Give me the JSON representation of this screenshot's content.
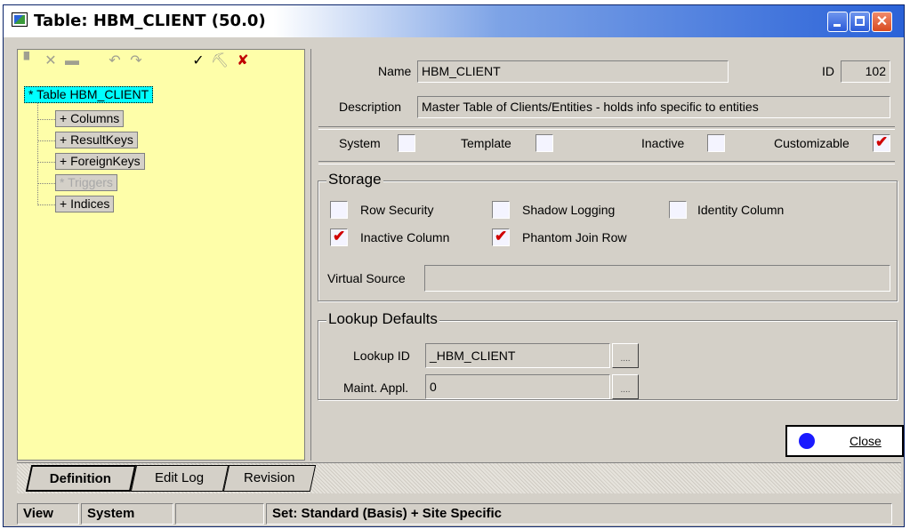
{
  "window": {
    "title": "Table: HBM_CLIENT (50.0)",
    "min_icon": "minimize-icon",
    "max_icon": "maximize-icon",
    "close_icon": "close-icon",
    "close_glyph": "✕"
  },
  "toolbar": {
    "icons": [
      "new-icon",
      "delete-icon",
      "folder-icon",
      "undo-icon",
      "redo-icon",
      "check-tool-icon",
      "pick-icon",
      "hammer-icon"
    ],
    "glyphs": {
      "new": "▘",
      "delete": "✕",
      "folder": "▬",
      "undo": "↶",
      "redo": "↷",
      "check": "✓",
      "pick": "⛏",
      "hammer": "✘"
    }
  },
  "tree": {
    "root": "* Table HBM_CLIENT",
    "items": [
      {
        "label": "+ Columns",
        "enabled": true
      },
      {
        "label": "+ ResultKeys",
        "enabled": true
      },
      {
        "label": "+ ForeignKeys",
        "enabled": true
      },
      {
        "label": "* Triggers",
        "enabled": false
      },
      {
        "label": "+ Indices",
        "enabled": true
      }
    ]
  },
  "form": {
    "name_label": "Name",
    "name_value": "HBM_CLIENT",
    "id_label": "ID",
    "id_value": "102",
    "description_label": "Description",
    "description_value": "Master Table of Clients/Entities - holds info specific to entities",
    "flags": {
      "system": {
        "label": "System",
        "checked": false
      },
      "template": {
        "label": "Template",
        "checked": false
      },
      "inactive": {
        "label": "Inactive",
        "checked": false
      },
      "customizable": {
        "label": "Customizable",
        "checked": true
      }
    }
  },
  "storage": {
    "title": "Storage",
    "row_security": {
      "label": "Row Security",
      "checked": false
    },
    "shadow_logging": {
      "label": "Shadow Logging",
      "checked": false
    },
    "identity_column": {
      "label": "Identity Column",
      "checked": false
    },
    "inactive_column": {
      "label": "Inactive Column",
      "checked": true
    },
    "phantom_join_row": {
      "label": "Phantom Join Row",
      "checked": true
    },
    "virtual_source_label": "Virtual Source",
    "virtual_source_value": ""
  },
  "lookup": {
    "title": "Lookup Defaults",
    "lookup_id_label": "Lookup ID",
    "lookup_id_value": "_HBM_CLIENT",
    "maint_label": "Maint. Appl.",
    "maint_value": "0",
    "ellipsis": "...."
  },
  "close_button": {
    "label": "Close"
  },
  "tabs": [
    {
      "label": "Definition",
      "active": true
    },
    {
      "label": "Edit Log",
      "active": false
    },
    {
      "label": "Revision",
      "active": false
    }
  ],
  "status": {
    "view": "View",
    "system": "System",
    "blank": "",
    "set": "Set: Standard  (Basis) + Site Specific"
  }
}
